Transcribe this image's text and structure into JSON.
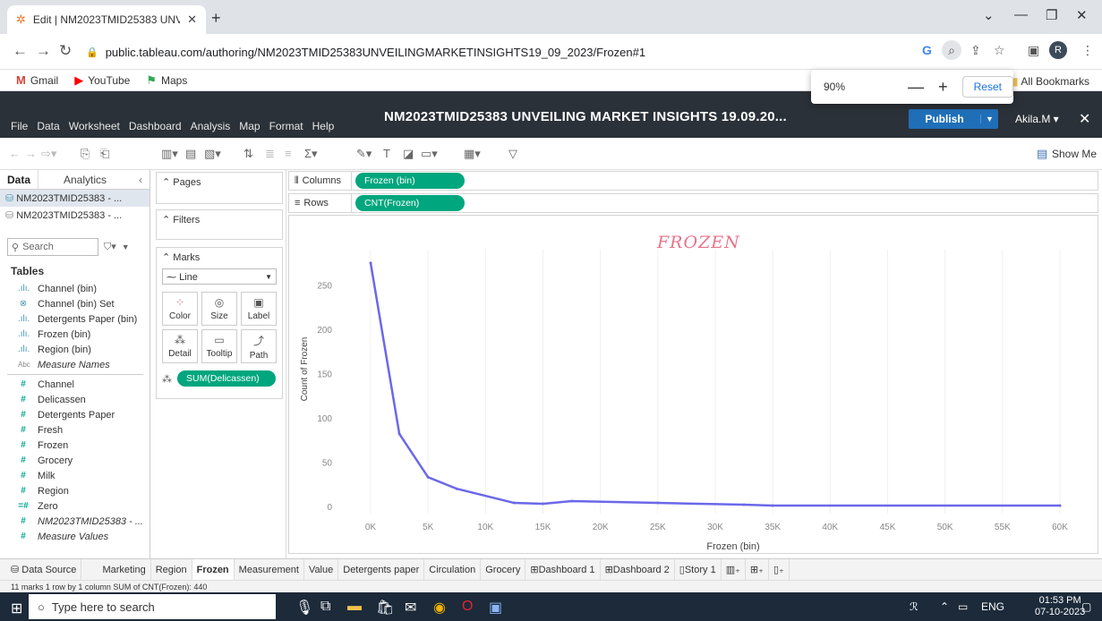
{
  "browser": {
    "tab_title": "Edit | NM2023TMID25383 UNVE",
    "url": "public.tableau.com/authoring/NM2023TMID25383UNVEILINGMARKETINSIGHTS19_09_2023/Frozen#1",
    "bookmarks": [
      "Gmail",
      "YouTube",
      "Maps"
    ],
    "all_bookmarks": "All Bookmarks",
    "profile_initial": "R",
    "zoom": {
      "level": "90%",
      "minus": "—",
      "plus": "+",
      "reset": "Reset"
    }
  },
  "tableau": {
    "menu": [
      "File",
      "Data",
      "Worksheet",
      "Dashboard",
      "Analysis",
      "Map",
      "Format",
      "Help"
    ],
    "workbook_title": "NM2023TMID25383 UNVEILING MARKET INSIGHTS 19.09.20...",
    "publish": "Publish",
    "user": "Akila.M ▾",
    "show_me": "Show Me"
  },
  "datapane": {
    "tabs": [
      "Data",
      "Analytics"
    ],
    "sources": [
      "NM2023TMID25383 - ...",
      "NM2023TMID25383 - ..."
    ],
    "search_placeholder": "Search",
    "tables_heading": "Tables",
    "fields": [
      {
        "icon": "dim",
        "glyph": ".ılı.",
        "name": "Channel (bin)"
      },
      {
        "icon": "dim",
        "glyph": "⊗",
        "name": "Channel (bin) Set"
      },
      {
        "icon": "dim",
        "glyph": ".ılı.",
        "name": "Detergents Paper (bin)"
      },
      {
        "icon": "dim",
        "glyph": ".ılı.",
        "name": "Frozen (bin)"
      },
      {
        "icon": "dim",
        "glyph": ".ılı.",
        "name": "Region (bin)"
      },
      {
        "icon": "abc",
        "glyph": "Abc",
        "name": "Measure Names",
        "italic": true
      },
      {
        "sep": true
      },
      {
        "icon": "meas",
        "glyph": "#",
        "name": "Channel"
      },
      {
        "icon": "meas",
        "glyph": "#",
        "name": "Delicassen"
      },
      {
        "icon": "meas",
        "glyph": "#",
        "name": "Detergents Paper"
      },
      {
        "icon": "meas",
        "glyph": "#",
        "name": "Fresh"
      },
      {
        "icon": "meas",
        "glyph": "#",
        "name": "Frozen"
      },
      {
        "icon": "meas",
        "glyph": "#",
        "name": "Grocery"
      },
      {
        "icon": "meas",
        "glyph": "#",
        "name": "Milk"
      },
      {
        "icon": "meas",
        "glyph": "#",
        "name": "Region"
      },
      {
        "icon": "meas",
        "glyph": "=#",
        "name": "Zero"
      },
      {
        "icon": "meas",
        "glyph": "#",
        "name": "NM2023TMID25383 - ...",
        "italic": true
      },
      {
        "icon": "meas",
        "glyph": "#",
        "name": "Measure Values",
        "italic": true
      }
    ]
  },
  "shelves": {
    "pages": "Pages",
    "filters": "Filters",
    "marks": "Marks",
    "mark_type": "Line",
    "mark_buttons": [
      "Color",
      "Size",
      "Label",
      "Detail",
      "Tooltip",
      "Path"
    ],
    "detail_pill": "SUM(Delicassen)",
    "columns_label": "Columns",
    "rows_label": "Rows",
    "columns_pill": "Frozen (bin)",
    "rows_pill": "CNT(Frozen)"
  },
  "chart_data": {
    "type": "line",
    "title": "FROZEN",
    "xlabel": "Frozen (bin)",
    "ylabel": "Count of Frozen",
    "x": [
      0,
      2500,
      5000,
      7500,
      12500,
      15000,
      17500,
      25000,
      32500,
      35000,
      60000
    ],
    "values": [
      275,
      82,
      33,
      20,
      4,
      3,
      6,
      4,
      2,
      1,
      1
    ],
    "x_ticks": [
      "0K",
      "5K",
      "10K",
      "15K",
      "20K",
      "25K",
      "30K",
      "35K",
      "40K",
      "45K",
      "50K",
      "55K",
      "60K"
    ],
    "y_ticks": [
      0,
      50,
      100,
      150,
      200,
      250
    ],
    "xlim": [
      0,
      60000
    ],
    "ylim": [
      0,
      290
    ],
    "color": "#6b68e8",
    "grid": true
  },
  "sheets": {
    "data_source": "Data Source",
    "tabs": [
      "Marketing",
      "Region",
      "Frozen",
      "Measurement",
      "Value",
      "Detergents paper",
      "Circulation",
      "Grocery",
      "Dashboard 1",
      "Dashboard 2",
      "Story 1"
    ],
    "active": "Frozen"
  },
  "status": "11 marks  1 row by 1 column  SUM of CNT(Frozen): 440",
  "taskbar": {
    "search_placeholder": "Type here to search",
    "lang": "ENG",
    "time": "01:53 PM",
    "date": "07-10-2023"
  }
}
